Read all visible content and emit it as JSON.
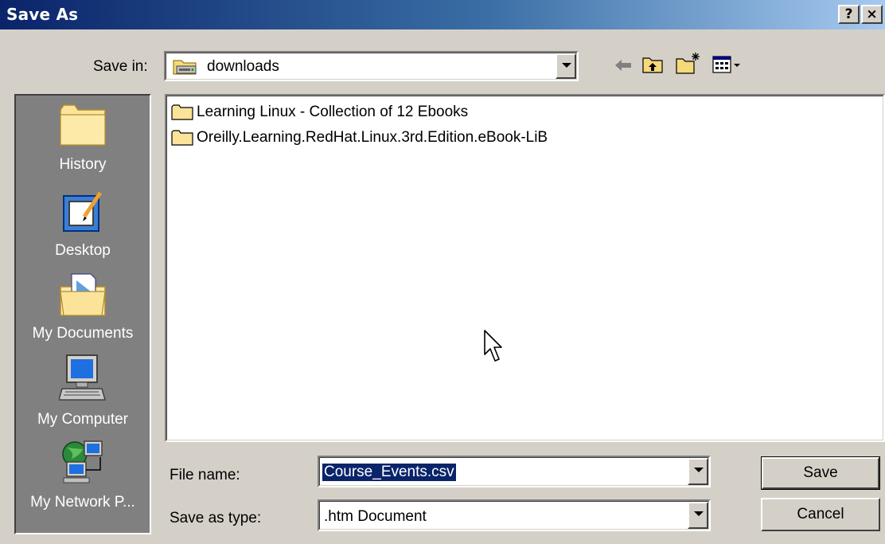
{
  "window": {
    "title": "Save As",
    "help_button": "?",
    "close_button": "×"
  },
  "toolbar": {
    "save_in_label": "Save in:",
    "save_in_value": "downloads"
  },
  "places": [
    {
      "label": "History",
      "icon": "history-folder-icon"
    },
    {
      "label": "Desktop",
      "icon": "desktop-icon"
    },
    {
      "label": "My Documents",
      "icon": "my-documents-icon"
    },
    {
      "label": "My Computer",
      "icon": "my-computer-icon"
    },
    {
      "label": "My Network P...",
      "icon": "my-network-places-icon"
    }
  ],
  "files": [
    {
      "name": "Learning Linux - Collection of 12 Ebooks",
      "type": "folder"
    },
    {
      "name": "Oreilly.Learning.RedHat.Linux.3rd.Edition.eBook-LiB",
      "type": "folder"
    }
  ],
  "form": {
    "file_name_label": "File name:",
    "file_name_value": "Course_Events.csv",
    "save_as_type_label": "Save as type:",
    "save_as_type_value": ".htm Document"
  },
  "buttons": {
    "save": "Save",
    "cancel": "Cancel"
  }
}
